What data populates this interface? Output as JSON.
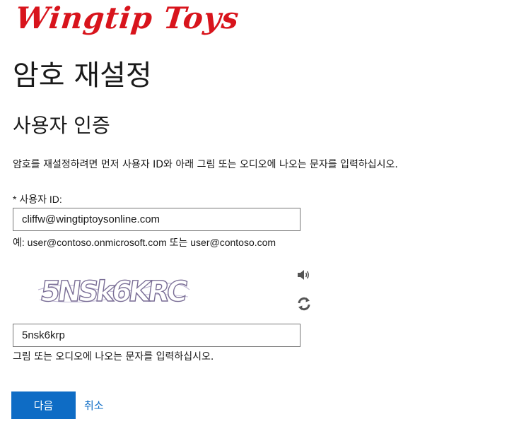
{
  "brand": {
    "logo_text": "Wingtip Toys",
    "logo_color": "#d8141c"
  },
  "page": {
    "title": "암호 재설정",
    "section_title": "사용자 인증",
    "instructions": "암호를 재설정하려면 먼저 사용자 ID와 아래 그림 또는 오디오에 나오는 문자를 입력하십시오."
  },
  "user_id": {
    "label": "* 사용자 ID:",
    "value": "cliffw@wingtiptoysonline.com",
    "example": "예: user@contoso.onmicrosoft.com 또는 user@contoso.com"
  },
  "captcha": {
    "image_text": "5NSk6KRC",
    "audio_icon": "speaker-icon",
    "refresh_icon": "refresh-icon",
    "input_value": "5nsk6krp",
    "hint": "그림 또는 오디오에 나오는 문자를 입력하십시오."
  },
  "actions": {
    "next_label": "다음",
    "cancel_label": "취소",
    "accent_color": "#0e6cc5"
  }
}
